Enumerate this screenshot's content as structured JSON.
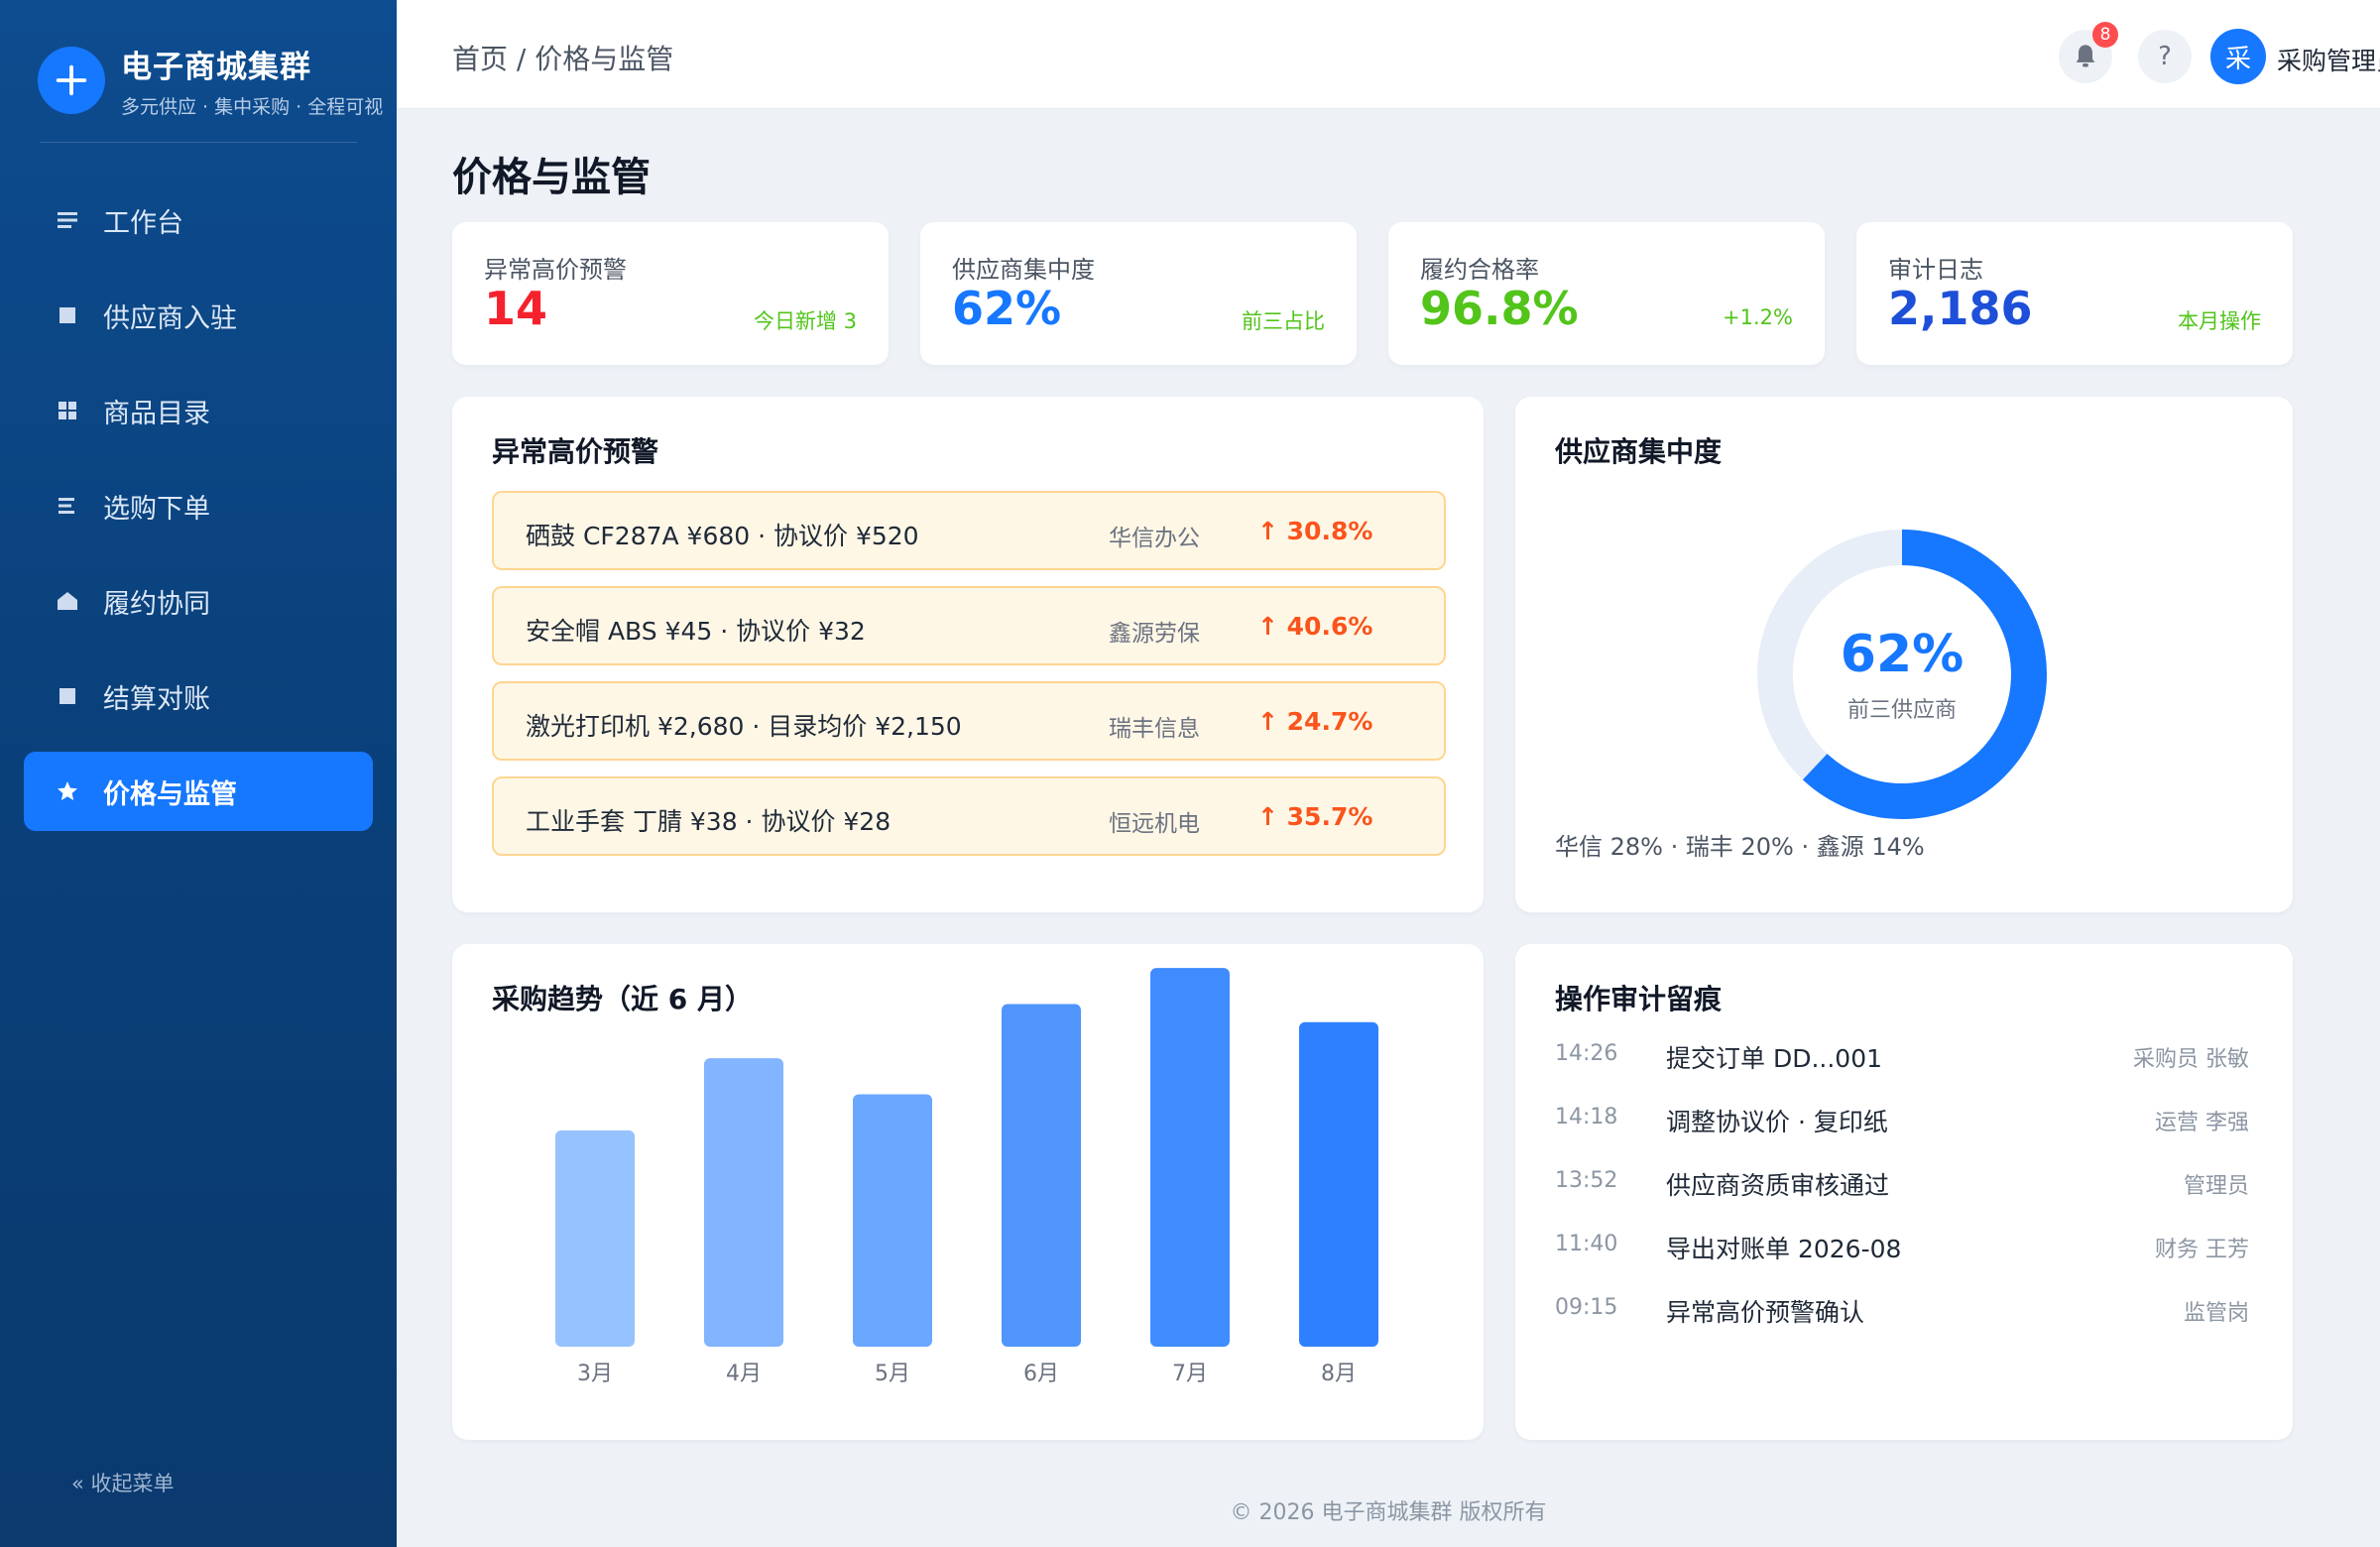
{
  "brand": {
    "title": "电子商城集群",
    "subtitle": "多元供应 · 集中采购 · 全程可视"
  },
  "sidebar": {
    "items": [
      {
        "label": "工作台",
        "icon": "list-icon"
      },
      {
        "label": "供应商入驻",
        "icon": "square-icon"
      },
      {
        "label": "商品目录",
        "icon": "grid-icon"
      },
      {
        "label": "选购下单",
        "icon": "list-icon"
      },
      {
        "label": "履约协同",
        "icon": "home-icon"
      },
      {
        "label": "结算对账",
        "icon": "square-icon"
      },
      {
        "label": "价格与监管",
        "icon": "star-icon",
        "active": true
      }
    ],
    "collapse_label": "« 收起菜单"
  },
  "header": {
    "breadcrumb": "首页 / 价格与监管",
    "notification_count": "8",
    "help_label": "?",
    "avatar_text": "采",
    "user_name": "采购管理员"
  },
  "page_title": "价格与监管",
  "kpis": [
    {
      "label": "异常高价预警",
      "value": "14",
      "note": "今日新增 3",
      "color": "#f5222d"
    },
    {
      "label": "供应商集中度",
      "value": "62%",
      "note": "前三占比",
      "color": "#1677ff"
    },
    {
      "label": "履约合格率",
      "value": "96.8%",
      "note": "+1.2%",
      "color": "#52c41a"
    },
    {
      "label": "审计日志",
      "value": "2,186",
      "note": "本月操作",
      "color": "#1d4fd8"
    }
  ],
  "alerts": {
    "title": "异常高价预警",
    "items": [
      {
        "text": "硒鼓 CF287A ¥680 · 协议价 ¥520",
        "supplier": "华信办公",
        "rate": "↑ 30.8%"
      },
      {
        "text": "安全帽 ABS ¥45 · 协议价 ¥32",
        "supplier": "鑫源劳保",
        "rate": "↑ 40.6%"
      },
      {
        "text": "激光打印机 ¥2,680 · 目录均价 ¥2,150",
        "supplier": "瑞丰信息",
        "rate": "↑ 24.7%"
      },
      {
        "text": "工业手套 丁腈 ¥38 · 协议价 ¥28",
        "supplier": "恒远机电",
        "rate": "↑ 35.7%"
      }
    ]
  },
  "concentration": {
    "title": "供应商集中度",
    "value": "62%",
    "fraction": 0.62,
    "label": "前三供应商",
    "legend": "华信 28% · 瑞丰 20% · 鑫源 14%",
    "color": "#1677ff"
  },
  "trend": {
    "title": "采购趋势（近 6 月）"
  },
  "chart_data": {
    "type": "bar",
    "categories": [
      "3月",
      "4月",
      "5月",
      "6月",
      "7月",
      "8月"
    ],
    "values": [
      60,
      80,
      70,
      95,
      105,
      90
    ],
    "ylim": [
      0,
      110
    ],
    "colors": [
      "#96c2ff",
      "#82b4ff",
      "#6aa7ff",
      "#4f95fb",
      "#3f8cff",
      "#2f80ff"
    ],
    "grid": false
  },
  "audit": {
    "title": "操作审计留痕",
    "rows": [
      {
        "time": "14:26",
        "action": "提交订单 DD...001",
        "user": "采购员 张敏"
      },
      {
        "time": "14:18",
        "action": "调整协议价 · 复印纸",
        "user": "运营 李强"
      },
      {
        "time": "13:52",
        "action": "供应商资质审核通过",
        "user": "管理员"
      },
      {
        "time": "11:40",
        "action": "导出对账单 2026-08",
        "user": "财务 王芳"
      },
      {
        "time": "09:15",
        "action": "异常高价预警确认",
        "user": "监管岗"
      }
    ]
  },
  "footer": "© 2026 电子商城集群 版权所有"
}
